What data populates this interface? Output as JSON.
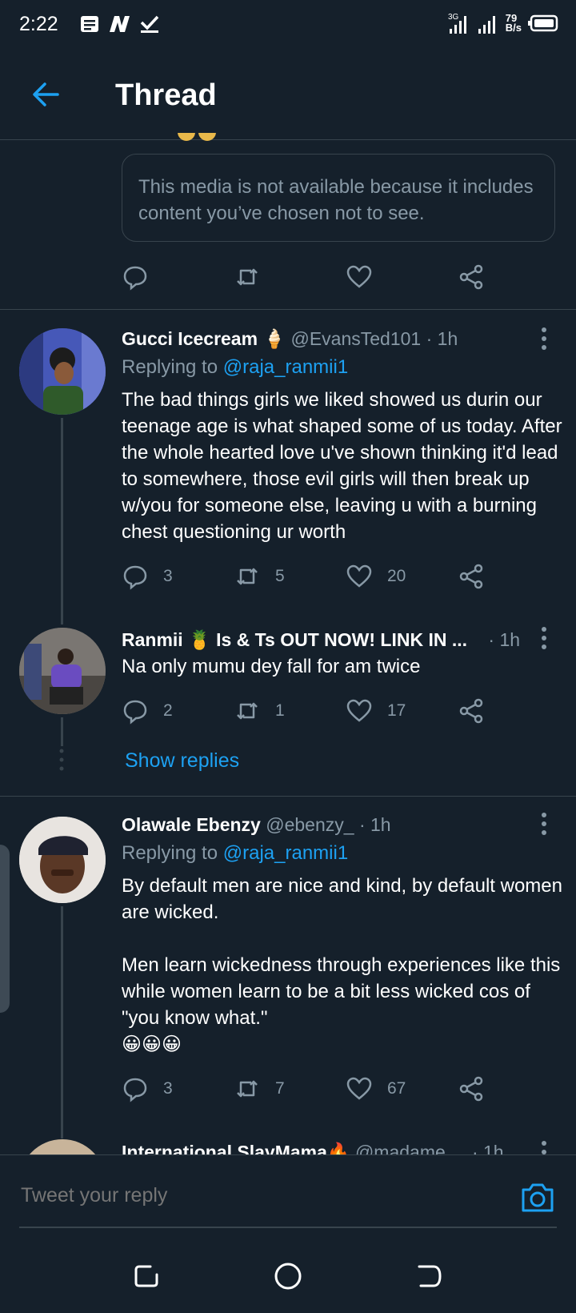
{
  "status_bar": {
    "time": "2:22",
    "notif_icons": [
      "document-icon",
      "n-app-icon",
      "check-icon"
    ],
    "net_speed": "79",
    "net_unit": "B/s",
    "network": "3G"
  },
  "header": {
    "title": "Thread"
  },
  "top_tweet": {
    "media_notice": "This media is not available because it includes content you’ve chosen not to see."
  },
  "tweets": [
    {
      "name": "Gucci Icecream 🍦",
      "handle": "@EvansTed101",
      "time": "· 1h",
      "replying_prefix": "Replying to ",
      "replying_to": "@raja_ranmii1",
      "text": "The bad things girls we liked showed us durin our teenage age is what shaped some of us today. After the whole hearted love u've shown thinking it'd lead to somewhere, those evil girls will then break up w/you for someone else, leaving u with a burning chest questioning ur worth",
      "replies": "3",
      "retweets": "5",
      "likes": "20"
    },
    {
      "name": "Ranmii 🍍 Is & Ts OUT NOW! LINK IN ...",
      "time": "· 1h",
      "text": "Na only mumu dey fall for am twice",
      "replies": "2",
      "retweets": "1",
      "likes": "17"
    },
    {
      "name": "Olawale Ebenzy",
      "handle": "@ebenzy_",
      "time": "· 1h",
      "replying_prefix": "Replying to ",
      "replying_to": "@raja_ranmii1",
      "text_1": "By default men are nice and kind, by default women are wicked.",
      "text_2": "Men learn wickedness through experiences like this while women learn to be a bit less wicked cos of \"you know what.\"",
      "text_3": "😀😀😀",
      "replies": "3",
      "retweets": "7",
      "likes": "67"
    },
    {
      "name": "International SlayMama🔥",
      "handle": "@madame_",
      "time": "· 1h"
    }
  ],
  "show_replies": "Show replies",
  "reply_bar": {
    "placeholder": "Tweet your reply"
  },
  "colors": {
    "background": "#15202b",
    "accent": "#1da1f2",
    "muted": "#8899a6",
    "border": "#38444d"
  }
}
